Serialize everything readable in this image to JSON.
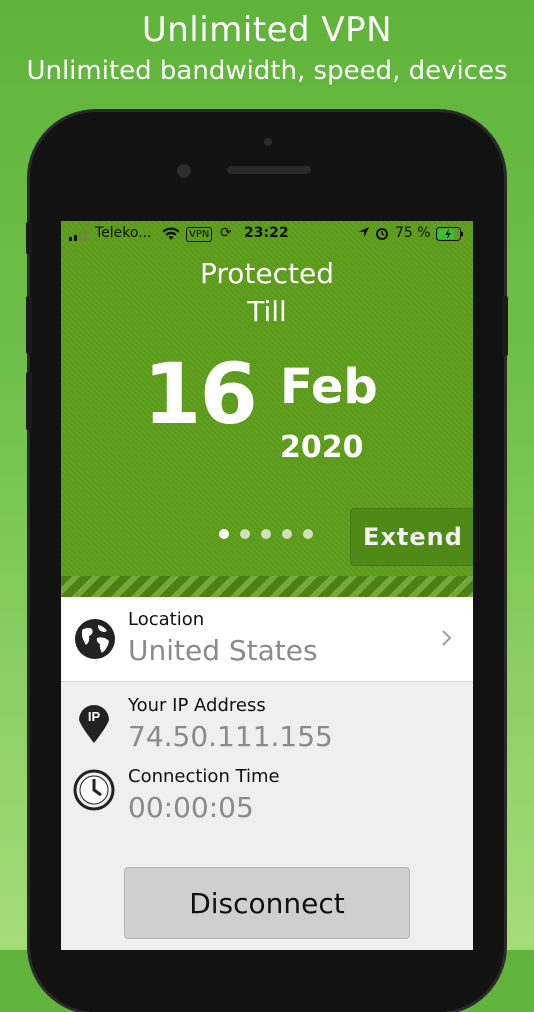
{
  "promo": {
    "title": "Unlimited VPN",
    "subtitle": "Unlimited bandwidth, speed, devices"
  },
  "status_bar": {
    "carrier": "Teleko...",
    "vpn_badge": "VPN",
    "time": "23:22",
    "battery": "75 %"
  },
  "hero": {
    "protected_label": "Protected",
    "till_label": "Till",
    "day": "16",
    "month": "Feb",
    "year": "2020",
    "pages_total": 5,
    "page_active": 1,
    "extend_label": "Extend"
  },
  "location": {
    "label": "Location",
    "value": "United States",
    "icon": "globe-icon"
  },
  "ip": {
    "label": "Your IP Address",
    "value": "74.50.111.155",
    "icon_text": "IP",
    "icon": "ip-pin-icon"
  },
  "connection": {
    "label": "Connection Time",
    "value": "00:00:05",
    "icon": "clock-icon"
  },
  "actions": {
    "disconnect_label": "Disconnect"
  },
  "colors": {
    "hero_green": "#5e9d1c",
    "extend_green": "#4f8a18"
  }
}
